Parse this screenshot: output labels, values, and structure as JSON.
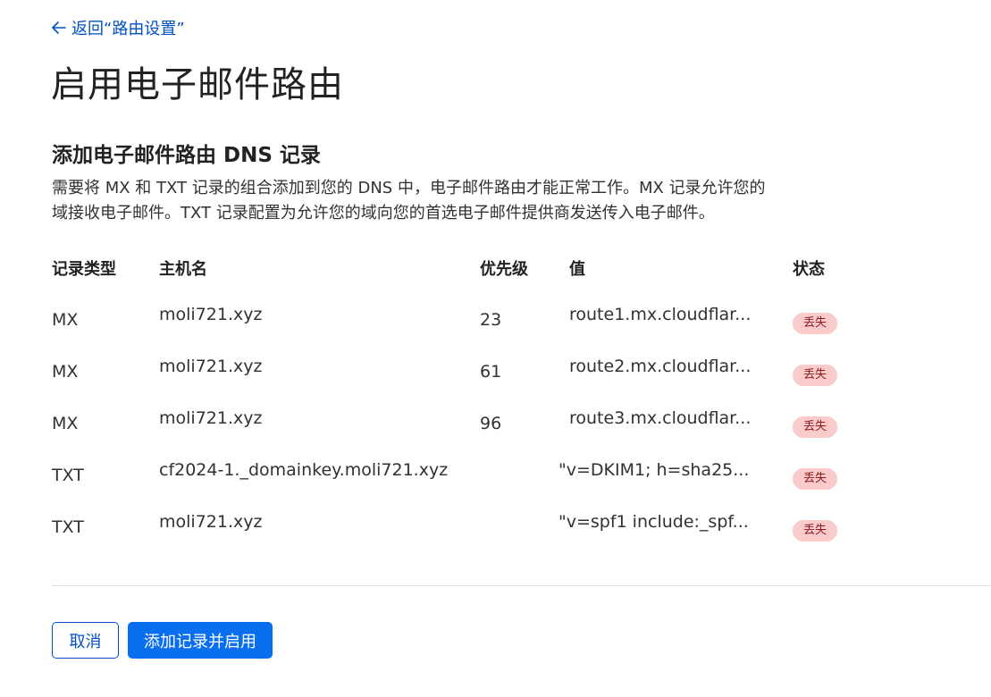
{
  "nav": {
    "back_label": "返回“路由设置”"
  },
  "page": {
    "title": "启用电子邮件路由"
  },
  "section": {
    "title": "添加电子邮件路由 DNS 记录",
    "description_line1": "需要将 MX 和 TXT 记录的组合添加到您的 DNS 中，电子邮件路由才能正常工作。MX 记录允许您的",
    "description_line2": "域接收电子邮件。TXT 记录配置为允许您的域向您的首选电子邮件提供商发送传入电子邮件。"
  },
  "table": {
    "headers": {
      "type": "记录类型",
      "host": "主机名",
      "priority": "优先级",
      "value": "值",
      "status": "状态"
    },
    "rows": [
      {
        "type": "MX",
        "host": "moli721.xyz",
        "priority": "23",
        "value": "route1.mx.cloudflar...",
        "status": "丢失"
      },
      {
        "type": "MX",
        "host": "moli721.xyz",
        "priority": "61",
        "value": "route2.mx.cloudflar...",
        "status": "丢失"
      },
      {
        "type": "MX",
        "host": "moli721.xyz",
        "priority": "96",
        "value": "route3.mx.cloudflar...",
        "status": "丢失"
      },
      {
        "type": "TXT",
        "host": "cf2024-1._domainkey.moli721.xyz",
        "priority": "",
        "value": "\"v=DKIM1; h=sha25...",
        "status": "丢失"
      },
      {
        "type": "TXT",
        "host": "moli721.xyz",
        "priority": "",
        "value": "\"v=spf1 include:_spf...",
        "status": "丢失"
      }
    ]
  },
  "actions": {
    "cancel_label": "取消",
    "submit_label": "添加记录并启用"
  },
  "colors": {
    "link": "#0051c3",
    "primary_button": "#0a6fef",
    "status_missing_bg": "#fbcaca",
    "status_missing_text": "#8e1b1b"
  },
  "icons": {
    "back": "arrow-left-icon"
  }
}
